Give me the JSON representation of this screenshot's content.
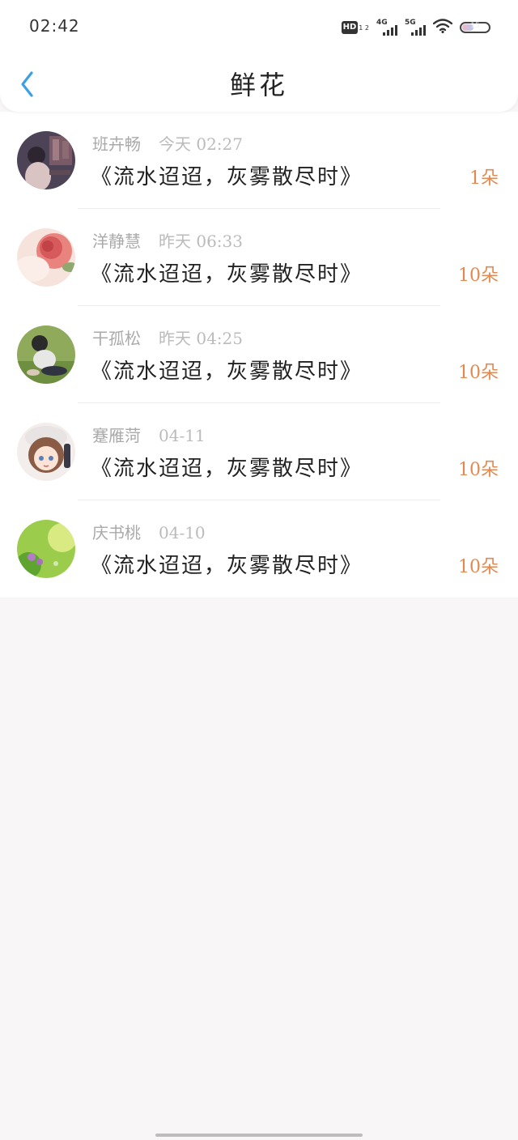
{
  "status_bar": {
    "time": "02:42",
    "hd_label": "HD",
    "hd_sub": "1 2",
    "signal1_label": "4G",
    "signal2_label": "5G",
    "battery_level": "15"
  },
  "header": {
    "title": "鲜花",
    "back_icon": "chevron-left-icon"
  },
  "colors": {
    "accent_back": "#3ba0e6",
    "count_color": "#e08a52",
    "name_color": "#aaaaaa",
    "message_color": "#222222",
    "background": "#f8f6f7"
  },
  "items": [
    {
      "name": "班卉畅",
      "date": "今天 02:27",
      "message": "《流水迢迢，灰雾散尽时》",
      "count": "1朵"
    },
    {
      "name": "洋静慧",
      "date": "昨天 06:33",
      "message": "《流水迢迢，灰雾散尽时》",
      "count": "10朵"
    },
    {
      "name": "干孤松",
      "date": "昨天 04:25",
      "message": "《流水迢迢，灰雾散尽时》",
      "count": "10朵"
    },
    {
      "name": "蹇雁菏",
      "date": "04-11",
      "message": "《流水迢迢，灰雾散尽时》",
      "count": "10朵"
    },
    {
      "name": "庆书桃",
      "date": "04-10",
      "message": "《流水迢迢，灰雾散尽时》",
      "count": "10朵"
    }
  ]
}
